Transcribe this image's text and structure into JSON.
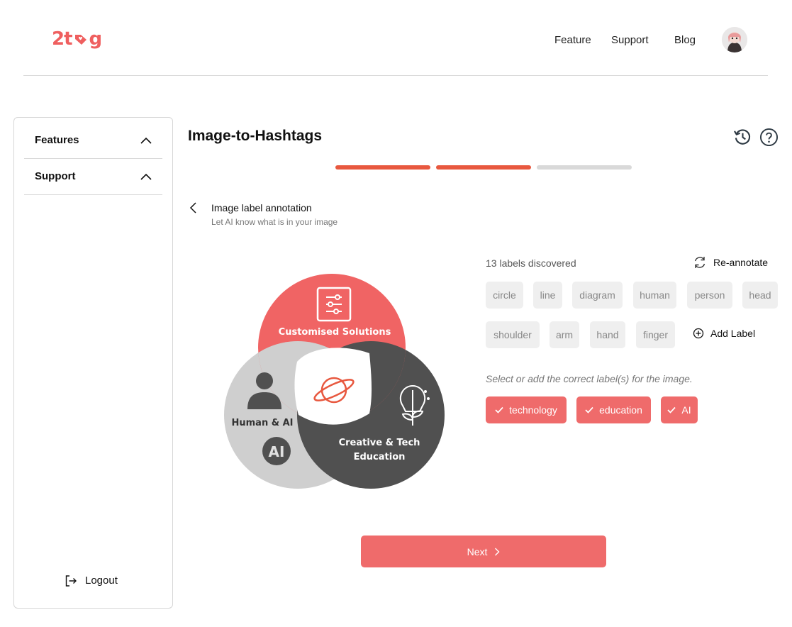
{
  "brand": {
    "logo_left": "2t",
    "logo_right": "g",
    "accent": "#ef5f5f"
  },
  "nav": {
    "items": [
      "Feature",
      "Support",
      "Blog"
    ]
  },
  "sidebar": {
    "items": [
      {
        "label": "Features",
        "icon": "chevron-up-icon"
      },
      {
        "label": "Support",
        "icon": "chevron-up-icon"
      }
    ],
    "logout": "Logout"
  },
  "page": {
    "title": "Image-to-Hashtags",
    "progress": {
      "total_steps": 3,
      "completed_steps": 2,
      "active_color": "#e8583f",
      "inactive_color": "#d9d9d9"
    }
  },
  "step": {
    "title": "Image label annotation",
    "subtitle": "Let AI know what is in your image"
  },
  "diagram": {
    "top": "Customised Solutions",
    "left": "Human & AI",
    "left_badge": "AI",
    "right_line1": "Creative & Tech",
    "right_line2": "Education",
    "colors": {
      "red": "#f06464",
      "grey": "#cfcfcf",
      "dark": "#505050"
    }
  },
  "labels": {
    "count_text": "13 labels discovered",
    "reannotate": "Re-annotate",
    "discovered": [
      "circle",
      "line",
      "diagram",
      "human",
      "person",
      "head",
      "shoulder",
      "arm",
      "hand",
      "finger"
    ],
    "add_label": "Add Label",
    "hint": "Select or add the correct label(s) for the image.",
    "selected": [
      "technology",
      "education",
      "AI"
    ]
  },
  "actions": {
    "next": "Next"
  }
}
